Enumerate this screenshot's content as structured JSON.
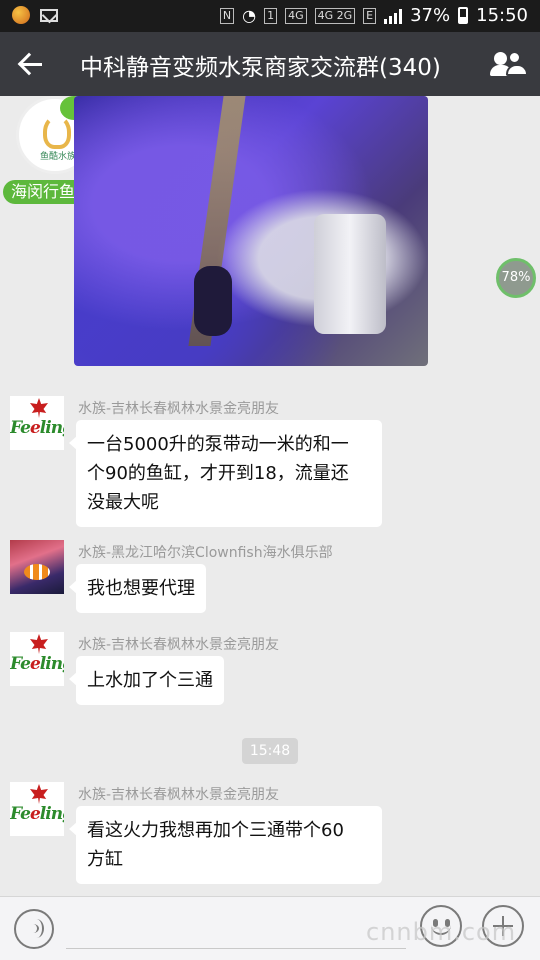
{
  "status_bar": {
    "battery_percent": "37%",
    "time": "15:50",
    "network_labels": [
      "4G",
      "4G 2G",
      "E"
    ],
    "icons": [
      "app-notification-icon",
      "mail-icon",
      "nfc-icon",
      "wifi-icon",
      "sim-1-icon",
      "signal-icon",
      "battery-icon"
    ]
  },
  "header": {
    "title": "中科静音变频水泵商家交流群(340)",
    "icons": [
      "back-arrow-icon",
      "group-members-icon"
    ]
  },
  "messages": [
    {
      "type": "image",
      "sender_nickname_pill": "海闵行鱼酷",
      "avatar_caption": "鱼酷水族"
    },
    {
      "type": "text",
      "sender": "水族-吉林长春枫林水景金亮朋友",
      "text_lines": [
        "一台5000升的泵带动一米的和一",
        "个90的鱼缸，才开到18，流量还",
        "没最大呢"
      ]
    },
    {
      "type": "text",
      "sender": "水族-黑龙江哈尔滨Clownfish海水俱乐部",
      "text_lines": [
        "我也想要代理"
      ]
    },
    {
      "type": "text",
      "sender": "水族-吉林长春枫林水景金亮朋友",
      "text_lines": [
        "上水加了个三通"
      ]
    },
    {
      "type": "time",
      "text": "15:48"
    },
    {
      "type": "text",
      "sender": "水族-吉林长春枫林水景金亮朋友",
      "text_lines": [
        "看这火力我想再加个三通带个60",
        "方缸"
      ]
    }
  ],
  "feeling_avatar": {
    "word_green": "Fe",
    "word_red": "e",
    "word_green2": "ling"
  },
  "download_progress": "78%",
  "input_bar": {
    "placeholder": "",
    "icons": [
      "voice-icon",
      "emoji-icon",
      "plus-icon"
    ]
  },
  "watermark": "cnnbm.com",
  "colors": {
    "title_bar": "#393a3f",
    "status_bar": "#1b1b1b",
    "chat_background": "#ebebeb",
    "nickname_pill": "#5db83c",
    "feeling_green": "#2c8b2c",
    "feeling_red": "#c81e1e"
  }
}
